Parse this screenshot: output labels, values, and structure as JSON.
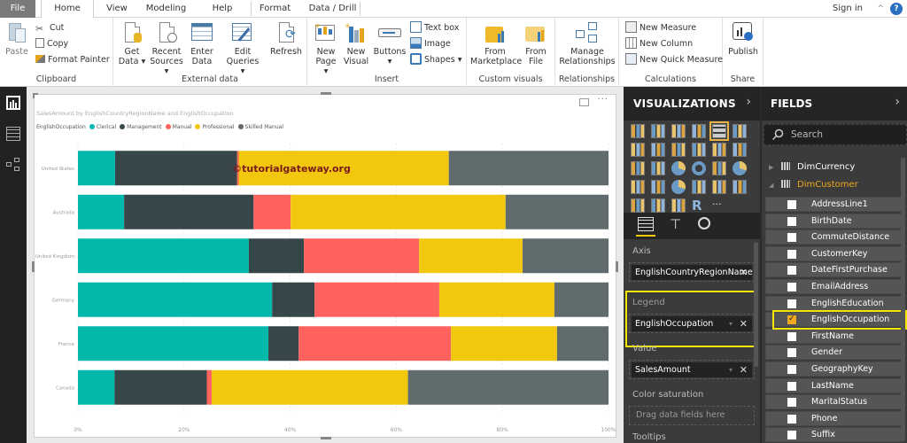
{
  "ribbon": {
    "tabs": [
      {
        "label": "File",
        "active": false
      },
      {
        "label": "Home",
        "active": true
      },
      {
        "label": "View",
        "active": false
      },
      {
        "label": "Modeling",
        "active": false
      },
      {
        "label": "Help",
        "active": false
      },
      {
        "label": "Format",
        "active": false
      },
      {
        "label": "Data / Drill",
        "active": false
      }
    ],
    "sign_in": "Sign in",
    "help_icon": "?",
    "groups": {
      "clipboard": {
        "label": "Clipboard",
        "paste": "Paste",
        "cut": "Cut",
        "copy": "Copy",
        "format_painter": "Format Painter"
      },
      "external_data": {
        "label": "External data",
        "get_data": [
          "Get",
          "Data ▾"
        ],
        "recent_sources": [
          "Recent",
          "Sources ▾"
        ],
        "enter_data": [
          "Enter",
          "Data"
        ],
        "edit_queries": [
          "Edit",
          "Queries ▾"
        ],
        "refresh": "Refresh"
      },
      "insert": {
        "label": "Insert",
        "new_page": [
          "New",
          "Page ▾"
        ],
        "new_visual": [
          "New",
          "Visual"
        ],
        "buttons": [
          "Buttons",
          "▾"
        ],
        "text_box": "Text box",
        "image": "Image",
        "shapes": "Shapes ▾"
      },
      "custom_visuals": {
        "label": "Custom visuals",
        "from_marketplace": [
          "From",
          "Marketplace"
        ],
        "from_file": [
          "From",
          "File"
        ]
      },
      "relationships": {
        "label": "Relationships",
        "manage": [
          "Manage",
          "Relationships"
        ]
      },
      "calculations": {
        "label": "Calculations",
        "new_measure": "New Measure",
        "new_column": "New Column",
        "new_quick_measure": "New Quick Measure"
      },
      "share": {
        "label": "Share",
        "publish": "Publish"
      }
    }
  },
  "left_nav": {
    "items": [
      "report-view",
      "data-view",
      "relationships-view"
    ]
  },
  "visual": {
    "more_options": "···",
    "watermark": "©tutorialgateway.org"
  },
  "chart_data": {
    "type": "bar",
    "orientation": "horizontal",
    "stacking": "100%",
    "title": "SalesAmount by EnglishCountryRegionName and EnglishOccupation",
    "legend_title": "EnglishOccupation",
    "legend_position": "top-left",
    "xlabel": "",
    "ylabel": "",
    "xlim": [
      0,
      100
    ],
    "x_ticks": [
      "0%",
      "20%",
      "40%",
      "60%",
      "80%",
      "100%"
    ],
    "grid": true,
    "categories": [
      "United States",
      "Australia",
      "United Kingdom",
      "Germany",
      "France",
      "Canada"
    ],
    "series": [
      {
        "name": "Clerical",
        "color": "#01B8AA",
        "values": [
          7.0,
          8.7,
          32.2,
          36.6,
          35.9,
          6.9
        ]
      },
      {
        "name": "Management",
        "color": "#374649",
        "values": [
          23.0,
          24.4,
          10.4,
          8.0,
          5.7,
          17.4
        ]
      },
      {
        "name": "Manual",
        "color": "#FD625E",
        "values": [
          0.3,
          7.0,
          21.7,
          23.5,
          28.7,
          0.9
        ]
      },
      {
        "name": "Professional",
        "color": "#F2C80F",
        "values": [
          39.6,
          40.5,
          19.5,
          21.7,
          20.0,
          37.0
        ]
      },
      {
        "name": "Skilled Manual",
        "color": "#5F6B6D",
        "values": [
          30.1,
          19.4,
          16.2,
          10.2,
          9.7,
          37.8
        ]
      }
    ]
  },
  "visualizations_pane": {
    "title": "VISUALIZATIONS",
    "selected_visual": "100% stacked bar chart",
    "tabs": [
      "fields",
      "format",
      "analytics"
    ],
    "wells": [
      {
        "label": "Axis",
        "value": "EnglishCountryRegionName",
        "highlighted": false
      },
      {
        "label": "Legend",
        "value": "EnglishOccupation",
        "highlighted": true
      },
      {
        "label": "Value",
        "value": "SalesAmount",
        "highlighted": false
      },
      {
        "label": "Color saturation",
        "value": null,
        "placeholder": "Drag data fields here",
        "highlighted": false
      },
      {
        "label": "Tooltips",
        "value": null,
        "highlighted": false
      }
    ]
  },
  "fields_pane": {
    "title": "FIELDS",
    "search_placeholder": "Search",
    "tables": [
      {
        "name": "DimCurrency",
        "expanded": false
      },
      {
        "name": "DimCustomer",
        "expanded": true
      }
    ],
    "fields": [
      {
        "name": "AddressLine1",
        "checked": false
      },
      {
        "name": "BirthDate",
        "checked": false
      },
      {
        "name": "CommuteDistance",
        "checked": false
      },
      {
        "name": "CustomerKey",
        "checked": false
      },
      {
        "name": "DateFirstPurchase",
        "checked": false
      },
      {
        "name": "EmailAddress",
        "checked": false
      },
      {
        "name": "EnglishEducation",
        "checked": false
      },
      {
        "name": "EnglishOccupation",
        "checked": true
      },
      {
        "name": "FirstName",
        "checked": false
      },
      {
        "name": "Gender",
        "checked": false
      },
      {
        "name": "GeographyKey",
        "checked": false
      },
      {
        "name": "LastName",
        "checked": false
      },
      {
        "name": "MaritalStatus",
        "checked": false
      },
      {
        "name": "Phone",
        "checked": false
      },
      {
        "name": "Suffix",
        "checked": false
      }
    ]
  },
  "colors": {
    "accent_highlight": "#F2E600",
    "active_table": "#F0A81C",
    "pane_bg": "#3B3B3B",
    "pane_header_bg": "#252525"
  }
}
